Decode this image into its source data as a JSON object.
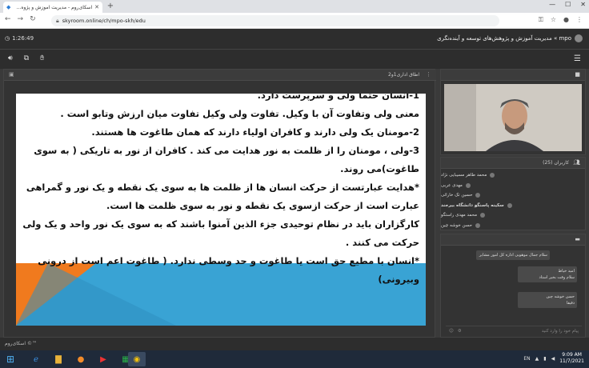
{
  "browser": {
    "tab_title": "اسکای‌روم - مدیریت آموزش و پژوه...",
    "url": "skyroom.online/ch/mpo-skh/edu",
    "new_tab": "+"
  },
  "header": {
    "timer": "1:26:49",
    "room_title": "mpo » مدیریت آموزش و پژوهش‌های توسعه و آینده‌نگری"
  },
  "main": {
    "panel_title": "اطاق اداری1و2",
    "lines": [
      "1-انسان حتما ولی و سرپرست دارد.",
      "معنی ولی وتفاوت آن با وکیل. تفاوت ولی وکیل تفاوت میان ارزش وتابو است .",
      "2-مومنان یک ولی دارند و کافران اولیاء دارند که همان طاغوت ها هستند.",
      "3-ولی ، مومنان را از ظلمت به نور هدایت می کند . کافران از نور به تاریکی ( به سوی طاغوت)می روند.",
      "*هدایت عبارتست از حرکت انسان ها از ظلمت ها  به سوی یک نقطه و یک نور و گمراهی عبارت است از حرکت ازسوی یک نقطه و نور به سوی ظلمت ها است.",
      "کارگزاران باید در نظام توحیدی جزء الذین آمنوا باشند که به سوی یک نور واحد و یک ولی حرکت می کنند .",
      "*انسان با مطیع حق است یا طاغوت و حد وسطی ندارد. ( طاغوت اعم است از درونی وبیرونی)"
    ]
  },
  "users": {
    "title": "کاربران (25)",
    "list": [
      "محمد طاهر مسیبایی نژاد",
      "مهدی عربی",
      "حسین تک خارائی",
      "سکینه پاسنگو دانشگاه بیرجند",
      "محمد مهدی راستگو",
      "حسن خوشه چین"
    ]
  },
  "chat": {
    "messages": [
      "سلام جمال موهوبی اداره کل امور مشایر",
      "امید خیاط",
      "سلام وقت بخیر استاد",
      "حسن خوشه چین",
      "دقیقا"
    ],
    "input_placeholder": "پیام خود را وارد کنید"
  },
  "footer": {
    "brand": "اسکای‌روم ©™"
  },
  "taskbar": {
    "lang": "EN",
    "time": "9:09 AM",
    "date": "11/7/2021"
  },
  "colors": {
    "slide_blue": "#39a3d4",
    "slide_orange": "#f07a1e",
    "dark_bg": "#2d2d2d"
  }
}
